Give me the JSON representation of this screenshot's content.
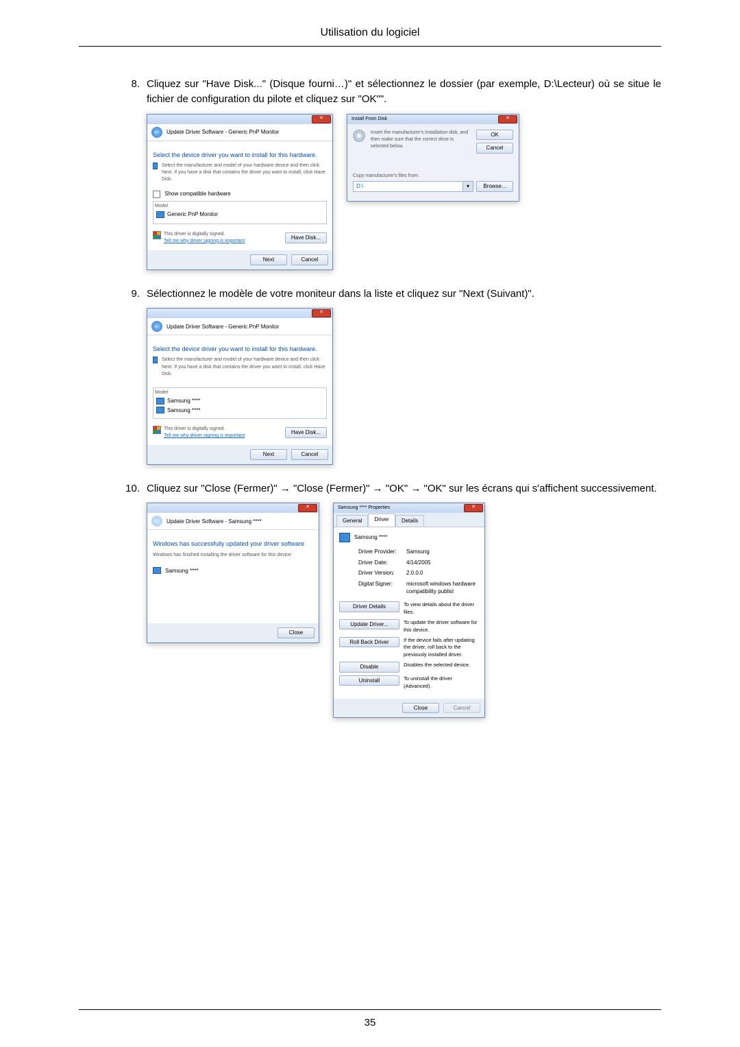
{
  "header": {
    "title": "Utilisation du logiciel"
  },
  "page_number": "35",
  "steps": [
    {
      "num": "8.",
      "text": "Cliquez sur \"Have Disk...\" (Disque fourni…)\" et sélectionnez le dossier (par exemple, D:\\Lecteur) où se situe le fichier de configuration du pilote et cliquez sur \"OK\"\"."
    },
    {
      "num": "9.",
      "text": "Sélectionnez le modèle de votre moniteur dans la liste et cliquez sur \"Next (Suivant)\"."
    },
    {
      "num": "10.",
      "text": "Cliquez sur \"Close (Fermer)\" → \"Close (Fermer)\" → \"OK\" → \"OK\" sur les écrans qui s'affichent successivement."
    }
  ],
  "dlg_select1": {
    "crumb": "Update Driver Software - Generic PnP Monitor",
    "heading": "Select the device driver you want to install for this hardware.",
    "desc": "Select the manufacturer and model of your hardware device and then click Next. If you have a disk that contains the driver you want to install, click Have Disk.",
    "compat_label": "Show compatible hardware",
    "model_label": "Model",
    "model_item": "Generic PnP Monitor",
    "signed": "This driver is digitally signed.",
    "tell_link": "Tell me why driver signing is important",
    "have_disk": "Have Disk...",
    "next": "Next",
    "cancel": "Cancel"
  },
  "dlg_install": {
    "title": "Install From Disk",
    "desc": "Insert the manufacturer's installation disk, and then make sure that the correct drive is selected below.",
    "ok": "OK",
    "cancel": "Cancel",
    "copy_label": "Copy manufacturer's files from:",
    "path": "D:\\",
    "browse": "Browse..."
  },
  "dlg_select2": {
    "crumb": "Update Driver Software - Generic PnP Monitor",
    "heading": "Select the device driver you want to install for this hardware.",
    "desc": "Select the manufacturer and model of your hardware device and then click Next. If you have a disk that contains the driver you want to install, click Have Disk.",
    "model_label": "Model",
    "item1": "Samsung ****",
    "item2": "Samsung ****",
    "signed": "This driver is digitally signed.",
    "tell_link": "Tell me why driver signing is important",
    "have_disk": "Have Disk...",
    "next": "Next",
    "cancel": "Cancel"
  },
  "dlg_done": {
    "crumb": "Update Driver Software - Samsung ****",
    "heading": "Windows has successfully updated your driver software",
    "desc": "Windows has finished installing the driver software for this device:",
    "device": "Samsung ****",
    "close": "Close"
  },
  "dlg_props": {
    "title": "Samsung **** Properties",
    "tabs": {
      "general": "General",
      "driver": "Driver",
      "details": "Details"
    },
    "device": "Samsung ****",
    "rows": {
      "provider_k": "Driver Provider:",
      "provider_v": "Samsung",
      "date_k": "Driver Date:",
      "date_v": "4/14/2005",
      "version_k": "Driver Version:",
      "version_v": "2.0.0.0",
      "signer_k": "Digital Signer:",
      "signer_v": "microsoft windows hardware compatibility publisl"
    },
    "btns": {
      "details": "Driver Details",
      "details_d": "To view details about the driver files.",
      "update": "Update Driver...",
      "update_d": "To update the driver software for this device.",
      "rollback": "Roll Back Driver",
      "rollback_d": "If the device fails after updating the driver, roll back to the previously installed driver.",
      "disable": "Disable",
      "disable_d": "Disables the selected device.",
      "uninstall": "Uninstall",
      "uninstall_d": "To uninstall the driver (Advanced)."
    },
    "close": "Close",
    "cancel": "Cancel"
  }
}
